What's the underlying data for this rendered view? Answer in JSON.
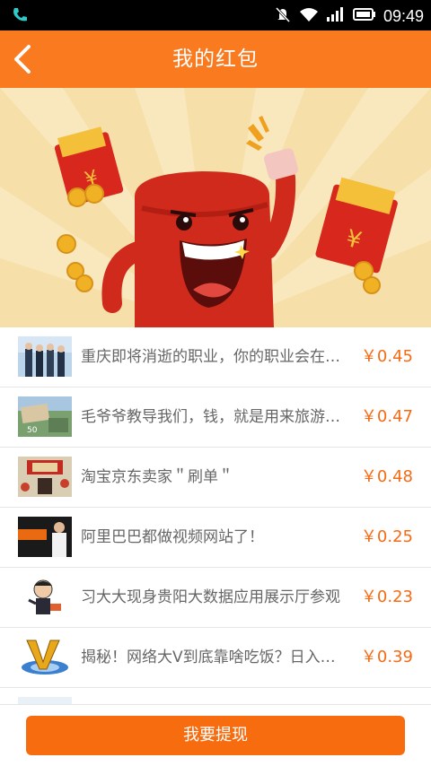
{
  "status_bar": {
    "time": "09:49",
    "icons": [
      "phone-icon",
      "mute-icon",
      "wifi-icon",
      "signal-icon",
      "battery-icon"
    ]
  },
  "header": {
    "title": "我的红包",
    "back_icon": "back-chevron-icon"
  },
  "colors": {
    "header_bg": "#f97a1f",
    "accent": "#f86c10",
    "amount": "#f56a12",
    "banner_bg": "#f6dfa8"
  },
  "items": [
    {
      "title": "重庆即将消逝的职业，你的职业会在其中吗？",
      "amount": "￥0.45"
    },
    {
      "title": "毛爷爷教导我们，钱，就是用来旅游的！",
      "amount": "￥0.47"
    },
    {
      "title": "淘宝京东卖家＂刷单＂",
      "amount": "￥0.48"
    },
    {
      "title": "阿里巴巴都做视频网站了！",
      "amount": "￥0.25"
    },
    {
      "title": "习大大现身贵阳大数据应用展示厅参观",
      "amount": "￥0.23"
    },
    {
      "title": "揭秘！网络大V到底靠啥吃饭？日入多少？",
      "amount": "￥0.39"
    }
  ],
  "footer": {
    "withdraw_label": "我要提现"
  }
}
